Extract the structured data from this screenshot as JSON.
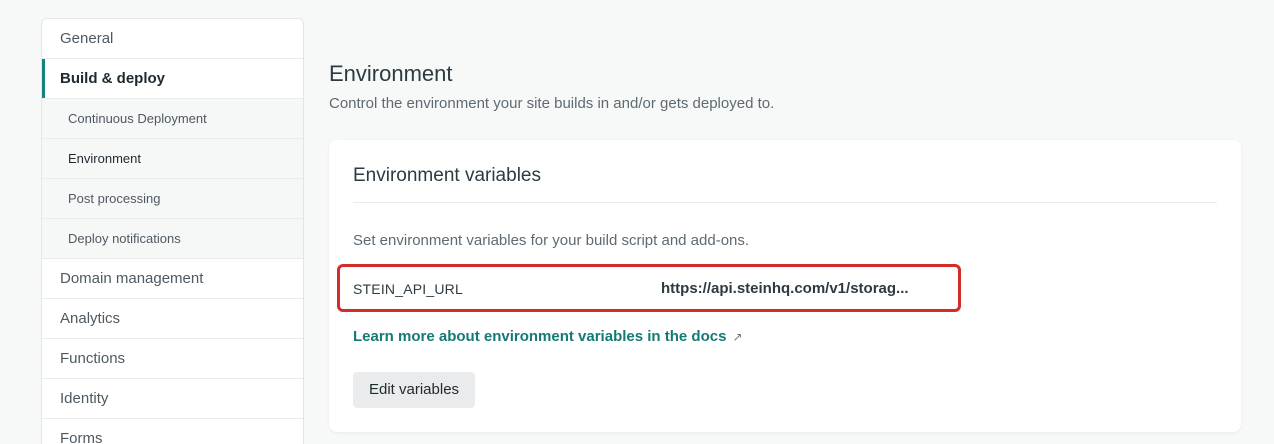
{
  "sidebar": {
    "items": [
      {
        "label": "General"
      },
      {
        "label": "Build & deploy"
      },
      {
        "label": "Domain management"
      },
      {
        "label": "Analytics"
      },
      {
        "label": "Functions"
      },
      {
        "label": "Identity"
      },
      {
        "label": "Forms"
      }
    ],
    "subitems": [
      {
        "label": "Continuous Deployment"
      },
      {
        "label": "Environment"
      },
      {
        "label": "Post processing"
      },
      {
        "label": "Deploy notifications"
      }
    ]
  },
  "main": {
    "title": "Environment",
    "subtitle": "Control the environment your site builds in and/or gets deployed to.",
    "card": {
      "title": "Environment variables",
      "description": "Set environment variables for your build script and add-ons.",
      "variables": [
        {
          "key": "STEIN_API_URL",
          "value": "https://api.steinhq.com/v1/storag..."
        }
      ],
      "docs_link": "Learn more about environment variables in the docs",
      "docs_link_icon": "↗",
      "edit_button": "Edit variables"
    }
  },
  "colors": {
    "accent": "#15847d",
    "highlight_border": "#d62b2b",
    "link": "#157a74"
  }
}
